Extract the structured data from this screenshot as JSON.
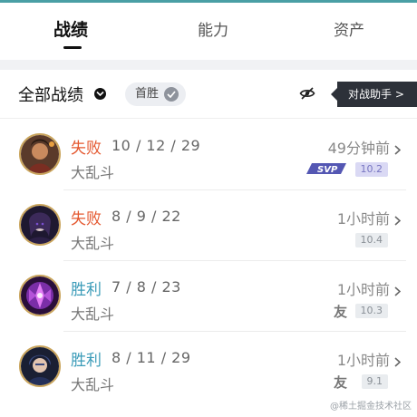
{
  "tabs": [
    {
      "label": "战绩",
      "active": true
    },
    {
      "label": "能力",
      "active": false
    },
    {
      "label": "资产",
      "active": false
    }
  ],
  "filter": {
    "title": "全部战绩",
    "chip_label": "首胜",
    "assist_label": "对战助手 >"
  },
  "matches": [
    {
      "result": "失败",
      "outcome": "lose",
      "kda": "10 / 12 / 29",
      "mode": "大乱斗",
      "time": "49分钟前",
      "version": "10.2",
      "badge": "SVP"
    },
    {
      "result": "失败",
      "outcome": "lose",
      "kda": "8 / 9 / 22",
      "mode": "大乱斗",
      "time": "1小时前",
      "version": "10.4",
      "badge": ""
    },
    {
      "result": "胜利",
      "outcome": "win",
      "kda": "7 / 8 / 23",
      "mode": "大乱斗",
      "time": "1小时前",
      "version": "10.3",
      "badge": "友"
    },
    {
      "result": "胜利",
      "outcome": "win",
      "kda": "8 / 11 / 29",
      "mode": "大乱斗",
      "time": "1小时前",
      "version": "9.1",
      "badge": "友"
    }
  ],
  "watermark": "@稀土掘金技术社区",
  "colors": {
    "lose": "#e4572e",
    "win": "#3a9bb8",
    "accent": "#4a9fa5",
    "dark_button": "#2d3139"
  }
}
